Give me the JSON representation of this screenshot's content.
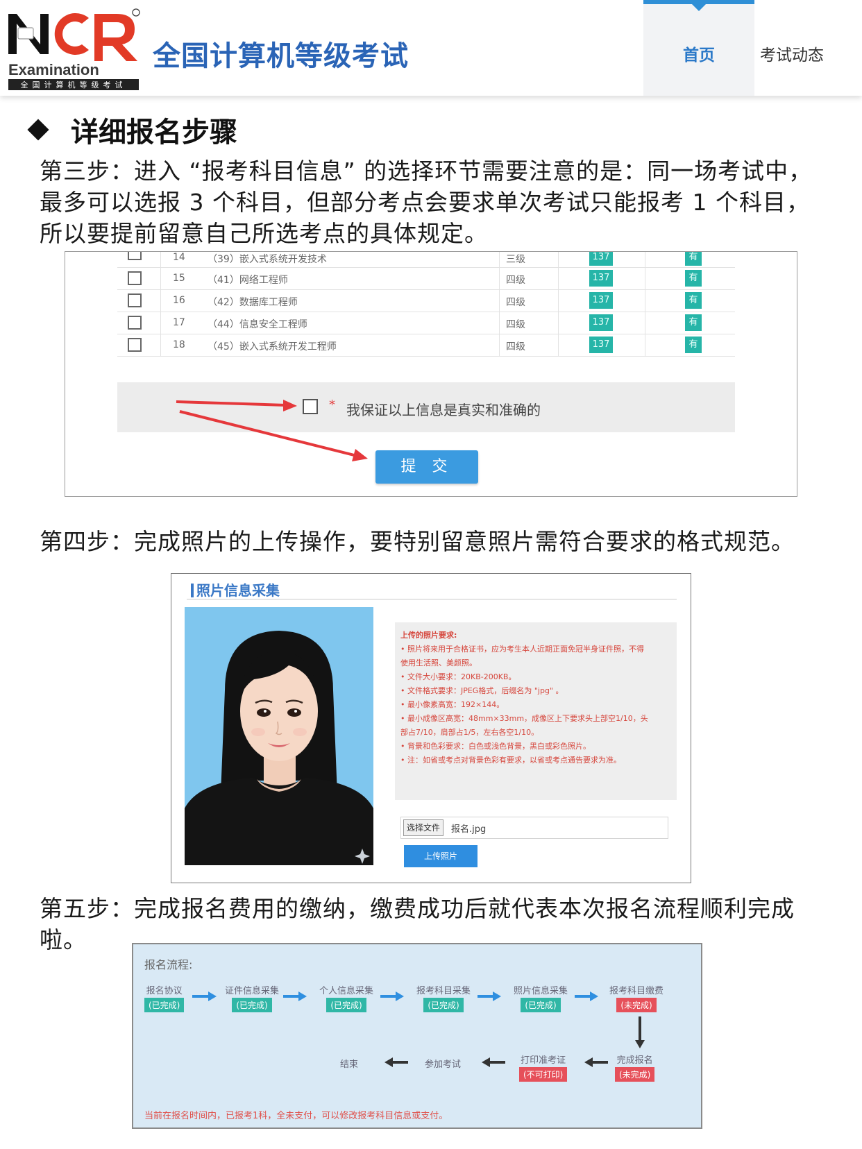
{
  "header": {
    "logo_text": "NCR",
    "logo_sub": "Examination",
    "logo_band": "全国计算机等级考试",
    "site_title": "全国计算机等级考试",
    "nav": [
      {
        "label": "首页",
        "active": true
      },
      {
        "label": "考试动态",
        "active": false
      }
    ]
  },
  "section": {
    "title": "详细报名步骤"
  },
  "steps": {
    "step3": "第三步：进入 “报考科目信息” 的选择环节需要注意的是：同一场考试中，最多可以选报 3 个科目，但部分考点会要求单次考试只能报考 1 个科目，所以要提前留意自己所选考点的具体规定。",
    "step4": "第四步：完成照片的上传操作，要特别留意照片需符合要求的格式规范。",
    "step5": "第五步：完成报名费用的缴纳，缴费成功后就代表本次报名流程顺利完成啦。"
  },
  "subjects_table": {
    "rows": [
      {
        "num": "14",
        "name": "（39）嵌入式系统开发技术",
        "level": "三级",
        "count": "137",
        "avail": "有"
      },
      {
        "num": "15",
        "name": "（41）网络工程师",
        "level": "四级",
        "count": "137",
        "avail": "有"
      },
      {
        "num": "16",
        "name": "（42）数据库工程师",
        "level": "四级",
        "count": "137",
        "avail": "有"
      },
      {
        "num": "17",
        "name": "（44）信息安全工程师",
        "level": "四级",
        "count": "137",
        "avail": "有"
      },
      {
        "num": "18",
        "name": "（45）嵌入式系统开发工程师",
        "level": "四级",
        "count": "137",
        "avail": "有"
      }
    ],
    "confirm_star": "*",
    "confirm_text": "我保证以上信息是真实和准确的",
    "submit_label": "提 交"
  },
  "photo_panel": {
    "title": "照片信息采集",
    "requirements_title": "上传的照片要求:",
    "requirements": [
      "• 照片将来用于合格证书，应为考生本人近期正面免冠半身证件照，不得",
      "使用生活照、美颜照。",
      "• 文件大小要求：20KB-200KB。",
      "• 文件格式要求：JPEG格式，后缀名为 \"jpg\" 。",
      "• 最小像素高宽：192×144。",
      "• 最小成像区高宽：48mm×33mm，成像区上下要求头上部空1/10，头",
      "部占7/10，肩部占1/5，左右各空1/10。",
      "• 背景和色彩要求：白色或浅色背景，黑白或彩色照片。",
      "• 注：如省或考点对背景色彩有要求，以省或考点通告要求为准。"
    ],
    "choose_file_label": "选择文件",
    "file_name": "报名.jpg",
    "upload_label": "上传照片",
    "colors": {
      "photo_bg": "#7fc6ee",
      "req_text": "#d6463c"
    }
  },
  "flow": {
    "title": "报名流程:",
    "top_steps": [
      {
        "name": "报名协议",
        "status": "(已完成)",
        "done": true
      },
      {
        "name": "证件信息采集",
        "status": "(已完成)",
        "done": true
      },
      {
        "name": "个人信息采集",
        "status": "(已完成)",
        "done": true
      },
      {
        "name": "报考科目采集",
        "status": "(已完成)",
        "done": true
      },
      {
        "name": "照片信息采集",
        "status": "(已完成)",
        "done": true
      },
      {
        "name": "报考科目缴费",
        "status": "(未完成)",
        "done": false
      }
    ],
    "bottom_steps": [
      {
        "name": "完成报名",
        "status": "(未完成)"
      },
      {
        "name": "打印准考证",
        "status": "(不可打印)"
      },
      {
        "name": "参加考试"
      },
      {
        "name": "结束"
      }
    ],
    "note": "当前在报名时间内，已报考1科，全未支付，可以修改报考科目信息或支付。"
  }
}
